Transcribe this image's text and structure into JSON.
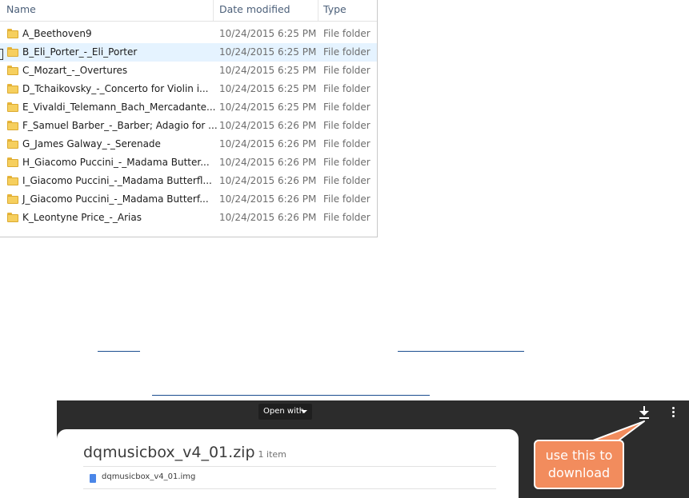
{
  "explorer": {
    "columns": {
      "name": "Name",
      "date": "Date modified",
      "type": "Type"
    },
    "rows": [
      {
        "name": "A_Beethoven9",
        "date": "10/24/2015 6:25 PM",
        "type": "File folder"
      },
      {
        "name": "B_Eli_Porter_-_Eli_Porter",
        "date": "10/24/2015 6:25 PM",
        "type": "File folder"
      },
      {
        "name": "C_Mozart_-_Overtures",
        "date": "10/24/2015 6:25 PM",
        "type": "File folder"
      },
      {
        "name": "D_Tchaikovsky_-_Concerto for Violin i...",
        "date": "10/24/2015 6:25 PM",
        "type": "File folder"
      },
      {
        "name": "E_Vivaldi_Telemann_Bach_Mercadante...",
        "date": "10/24/2015 6:25 PM",
        "type": "File folder"
      },
      {
        "name": "F_Samuel Barber_-_Barber; Adagio for ...",
        "date": "10/24/2015 6:26 PM",
        "type": "File folder"
      },
      {
        "name": "G_James Galway_-_Serenade",
        "date": "10/24/2015 6:26 PM",
        "type": "File folder"
      },
      {
        "name": "H_Giacomo Puccini_-_Madama Butter...",
        "date": "10/24/2015 6:26 PM",
        "type": "File folder"
      },
      {
        "name": "I_Giacomo Puccini_-_Madama Butterfl...",
        "date": "10/24/2015 6:26 PM",
        "type": "File folder"
      },
      {
        "name": "J_Giacomo Puccini_-_Madama Butterf...",
        "date": "10/24/2015 6:26 PM",
        "type": "File folder"
      },
      {
        "name": "K_Leontyne Price_-_Arias",
        "date": "10/24/2015 6:26 PM",
        "type": "File folder"
      }
    ],
    "selected_index": 1,
    "icon": "folder-icon"
  },
  "viewer": {
    "open_with_label": "Open with",
    "download_icon": "download-icon",
    "more_icon": "more-vert-icon",
    "archive_name": "dqmusicbox_v4_01.zip",
    "item_count": "1 item",
    "file_name": "dqmusicbox_v4_01.img",
    "file_icon": "file-icon",
    "callout_text": "use this to download"
  },
  "colors": {
    "selection": "#e5f3ff",
    "folder": "#f6cf5e",
    "viewer_bg": "#2c2c2c",
    "callout": "#f28c5d",
    "link": "#1a4d8f"
  }
}
